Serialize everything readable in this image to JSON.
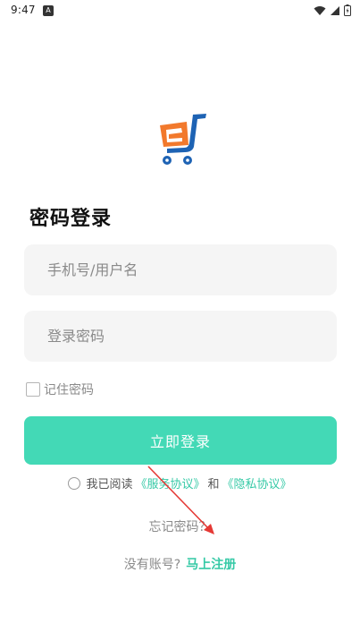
{
  "status_bar": {
    "time": "9:47",
    "notification_icon": "a-letter-icon",
    "icons": [
      "wifi-icon",
      "signal-icon",
      "battery-icon"
    ]
  },
  "logo": {
    "icon": "shopping-cart-icon",
    "colors": {
      "orange": "#F2792C",
      "blue": "#1E63B4"
    }
  },
  "title": "密码登录",
  "form": {
    "username_placeholder": "手机号/用户名",
    "password_placeholder": "登录密码",
    "remember_label": "记住密码",
    "remember_checked": false
  },
  "login_button": {
    "label": "立即登录"
  },
  "agreement": {
    "checked": false,
    "prefix": "我已阅读",
    "service_link": "《服务协议》",
    "conjunction": "和",
    "privacy_link": "《隐私协议》"
  },
  "forgot_password": "忘记密码？",
  "register": {
    "question": "没有账号?",
    "link": "马上注册"
  },
  "theme": {
    "accent": "#43D9B6",
    "link": "#35C9A6",
    "input_bg": "#F5F5F5",
    "annotation": "#E53935"
  }
}
